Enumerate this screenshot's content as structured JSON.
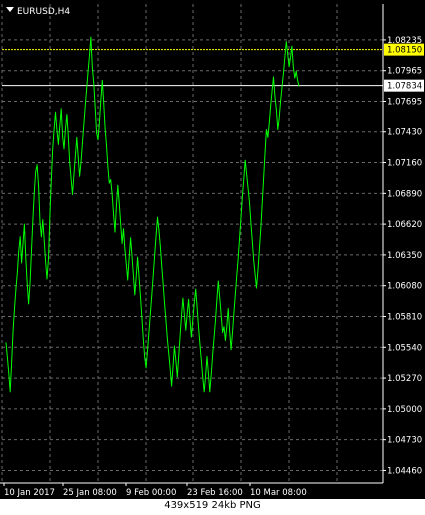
{
  "window": {
    "symbol_label": "EURUSD,H4",
    "caption": "439x519  24kb  PNG"
  },
  "colors": {
    "background": "#000000",
    "grid": "#6a6a6a",
    "price_line": "#00ff00",
    "axis_text": "#ffffff",
    "bid_line": "#ffff00",
    "bid_label_bg": "#ffff00",
    "ask_line": "#ffffff",
    "ask_label_bg": "#ffffff"
  },
  "chart_data": {
    "type": "line",
    "symbol": "EURUSD",
    "timeframe": "H4",
    "grid": true,
    "y_ticks": [
      "1.08235",
      "1.07965",
      "1.07695",
      "1.07430",
      "1.07160",
      "1.06890",
      "1.06620",
      "1.06350",
      "1.06080",
      "1.05810",
      "1.05540",
      "1.05270",
      "1.05000",
      "1.04730",
      "1.04460"
    ],
    "x_ticks": [
      "10 Jan 2017",
      "25 Jan 08:00",
      "9 Feb 00:00",
      "23 Feb 16:00",
      "10 Mar 08:00"
    ],
    "ylim": [
      1.0435,
      1.0855
    ],
    "price_labels": [
      {
        "value": 1.0815,
        "text": "1.08150",
        "kind": "bid"
      },
      {
        "value": 1.07834,
        "text": "1.07834",
        "kind": "reference"
      }
    ],
    "series": [
      {
        "values": [
          1.0558,
          1.0545,
          1.0531,
          1.0515,
          1.0542,
          1.0569,
          1.0588,
          1.0605,
          1.0619,
          1.0638,
          1.0651,
          1.0628,
          1.0645,
          1.0662,
          1.0632,
          1.061,
          1.0592,
          1.0611,
          1.0639,
          1.0666,
          1.069,
          1.0708,
          1.0714,
          1.0695,
          1.0664,
          1.0651,
          1.0666,
          1.0648,
          1.0629,
          1.0614,
          1.0632,
          1.0669,
          1.07,
          1.0728,
          1.0745,
          1.076,
          1.0744,
          1.0732,
          1.0748,
          1.0763,
          1.0739,
          1.0728,
          1.0745,
          1.0758,
          1.0739,
          1.0716,
          1.0702,
          1.0688,
          1.0705,
          1.0722,
          1.0738,
          1.0721,
          1.0704,
          1.0716,
          1.0733,
          1.075,
          1.0766,
          1.0781,
          1.0796,
          1.081,
          1.0826,
          1.08,
          1.0785,
          1.0764,
          1.0742,
          1.0736,
          1.0751,
          1.077,
          1.0788,
          1.0768,
          1.0746,
          1.0731,
          1.0712,
          1.0698,
          1.0701,
          1.0688,
          1.067,
          1.0655,
          1.0678,
          1.0696,
          1.0681,
          1.0662,
          1.0645,
          1.0658,
          1.064,
          1.0627,
          1.0613,
          1.0632,
          1.065,
          1.0634,
          1.0617,
          1.06,
          1.0616,
          1.0633,
          1.0615,
          1.0598,
          1.058,
          1.0561,
          1.0545,
          1.0536,
          1.0551,
          1.0568,
          1.0584,
          1.06,
          1.0617,
          1.0634,
          1.0651,
          1.0668,
          1.0657,
          1.0643,
          1.0626,
          1.061,
          1.0593,
          1.0578,
          1.0561,
          1.0548,
          1.0535,
          1.052,
          1.0537,
          1.0555,
          1.0542,
          1.0528,
          1.0546,
          1.0564,
          1.0582,
          1.0597,
          1.0583,
          1.0569,
          1.0584,
          1.0596,
          1.0578,
          1.0563,
          1.0578,
          1.0593,
          1.0605,
          1.0589,
          1.0572,
          1.0557,
          1.0543,
          1.0528,
          1.0515,
          1.0529,
          1.0546,
          1.0531,
          1.0515,
          1.053,
          1.0548,
          1.0563,
          1.0578,
          1.0596,
          1.0612,
          1.0598,
          1.0583,
          1.0567,
          1.0572,
          1.056,
          1.0572,
          1.0588,
          1.0569,
          1.0552,
          1.0567,
          1.0584,
          1.06,
          1.0616,
          1.0631,
          1.065,
          1.0668,
          1.0686,
          1.0702,
          1.0718,
          1.0706,
          1.0694,
          1.0681,
          1.0663,
          1.0647,
          1.063,
          1.0618,
          1.0606,
          1.0622,
          1.064,
          1.0658,
          1.068,
          1.0702,
          1.0724,
          1.0745,
          1.0738,
          1.0751,
          1.0766,
          1.0779,
          1.0791,
          1.0774,
          1.0762,
          1.0745,
          1.0755,
          1.077,
          1.0782,
          1.0794,
          1.0808,
          1.0822,
          1.0811,
          1.08,
          1.0808,
          1.0818,
          1.08,
          1.079,
          1.0796,
          1.0788,
          1.0783
        ]
      }
    ]
  }
}
